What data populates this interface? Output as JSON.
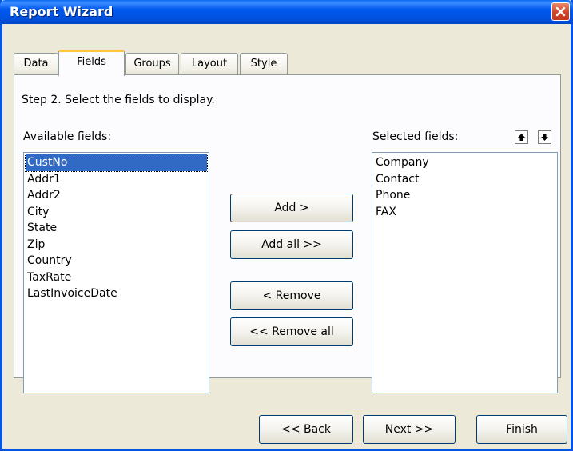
{
  "window": {
    "title": "Report Wizard"
  },
  "tabs": [
    {
      "label": "Data",
      "active": false
    },
    {
      "label": "Fields",
      "active": true
    },
    {
      "label": "Groups",
      "active": false
    },
    {
      "label": "Layout",
      "active": false
    },
    {
      "label": "Style",
      "active": false
    }
  ],
  "step_text": "Step 2. Select the fields to display.",
  "available": {
    "label": "Available fields:",
    "items": [
      "CustNo",
      "Addr1",
      "Addr2",
      "City",
      "State",
      "Zip",
      "Country",
      "TaxRate",
      "LastInvoiceDate"
    ],
    "selected_item": "CustNo"
  },
  "selected": {
    "label": "Selected fields:",
    "items": [
      "Company",
      "Contact",
      "Phone",
      "FAX"
    ]
  },
  "actions": {
    "add": "Add >",
    "add_all": "Add all >>",
    "remove": "< Remove",
    "remove_all": "<< Remove all"
  },
  "nav": {
    "back": "<< Back",
    "next": "Next >>",
    "finish": "Finish"
  },
  "icons": {
    "close": "close-icon",
    "move_up": "arrow-up-icon",
    "move_down": "arrow-down-icon"
  },
  "colors": {
    "titlebar": "#0058ee",
    "active_tab_accent": "#ffc83c",
    "selection": "#316ac5",
    "dialog_bg": "#ece9d8"
  }
}
